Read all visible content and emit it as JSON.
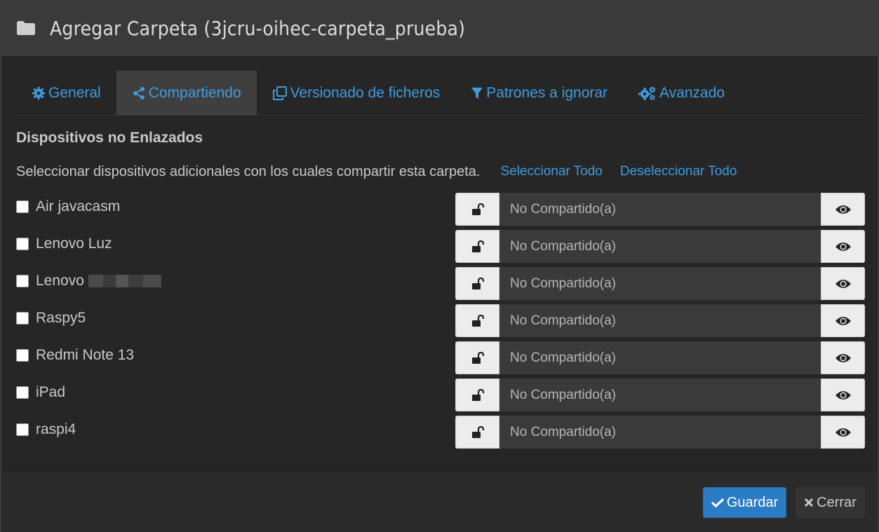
{
  "header": {
    "title": "Agregar Carpeta (3jcru-oihec-carpeta_prueba)",
    "icon": "folder-icon"
  },
  "tabs": [
    {
      "label": "General",
      "icon": "gear-icon",
      "active": false
    },
    {
      "label": "Compartiendo",
      "icon": "share-icon",
      "active": true
    },
    {
      "label": "Versionado de ficheros",
      "icon": "copy-icon",
      "active": false
    },
    {
      "label": "Patrones a ignorar",
      "icon": "filter-icon",
      "active": false
    },
    {
      "label": "Avanzado",
      "icon": "gears-icon",
      "active": false
    }
  ],
  "section": {
    "title": "Dispositivos no Enlazados",
    "intro": "Seleccionar dispositivos adicionales con los cuales compartir esta carpeta.",
    "select_all": "Seleccionar Todo",
    "deselect_all": "Deseleccionar Todo"
  },
  "devices": [
    {
      "name": "Air javacasm",
      "checked": false,
      "share_placeholder": "No Compartido(a)",
      "redacted": false
    },
    {
      "name": "Lenovo Luz",
      "checked": false,
      "share_placeholder": "No Compartido(a)",
      "redacted": false
    },
    {
      "name": "Lenovo",
      "checked": false,
      "share_placeholder": "No Compartido(a)",
      "redacted": true
    },
    {
      "name": "Raspy5",
      "checked": false,
      "share_placeholder": "No Compartido(a)",
      "redacted": false
    },
    {
      "name": "Redmi Note 13",
      "checked": false,
      "share_placeholder": "No Compartido(a)",
      "redacted": false
    },
    {
      "name": "iPad",
      "checked": false,
      "share_placeholder": "No Compartido(a)",
      "redacted": false
    },
    {
      "name": "raspi4",
      "checked": false,
      "share_placeholder": "No Compartido(a)",
      "redacted": false
    }
  ],
  "footer": {
    "save_label": "Guardar",
    "close_label": "Cerrar"
  },
  "colors": {
    "accent": "#3f9ce0",
    "primary_button": "#2a7cc4",
    "background": "#262626",
    "header_bg": "#3a3a3a"
  }
}
